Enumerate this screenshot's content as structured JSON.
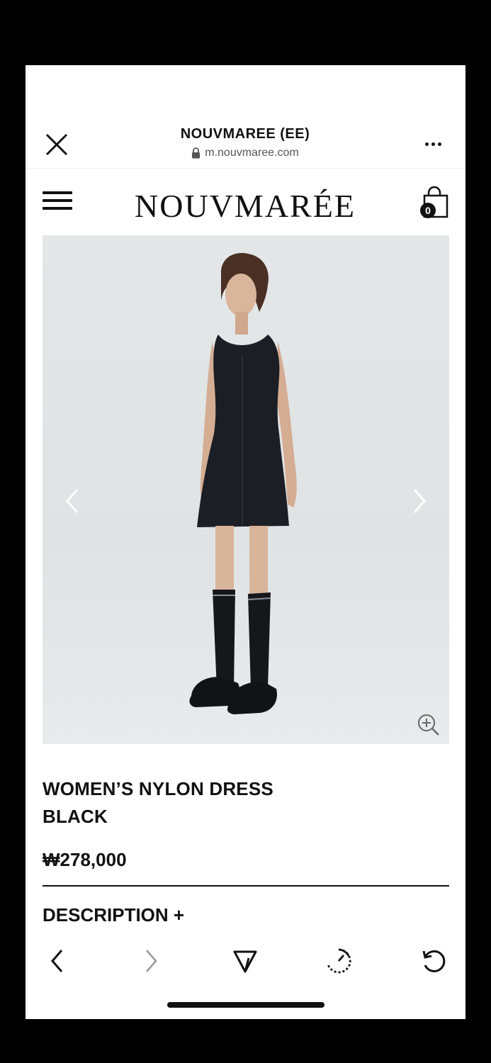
{
  "browser": {
    "title": "NOUVMAREE (EE)",
    "url": "m.nouvmaree.com"
  },
  "site": {
    "logo_text": "NOUVMARÉE",
    "cart_count": "0"
  },
  "product": {
    "name": "WOMEN’S NYLON DRESS BLACK",
    "price": "₩278,000",
    "description_label": "DESCRIPTION +"
  },
  "icons": {
    "close": "close-icon",
    "lock": "lock-icon",
    "more": "more-icon",
    "menu": "hamburger-menu-icon",
    "cart": "shopping-bag-icon",
    "prev_image": "chevron-left-icon",
    "next_image": "chevron-right-icon",
    "zoom": "zoom-in-icon",
    "back": "back-arrow-icon",
    "forward": "forward-arrow-icon",
    "share": "share-send-icon",
    "speed": "speed-gauge-icon",
    "reload": "reload-icon"
  },
  "colors": {
    "text": "#111111",
    "image_background": "#e2e6e7",
    "forward_disabled": "#9a9a9a"
  }
}
